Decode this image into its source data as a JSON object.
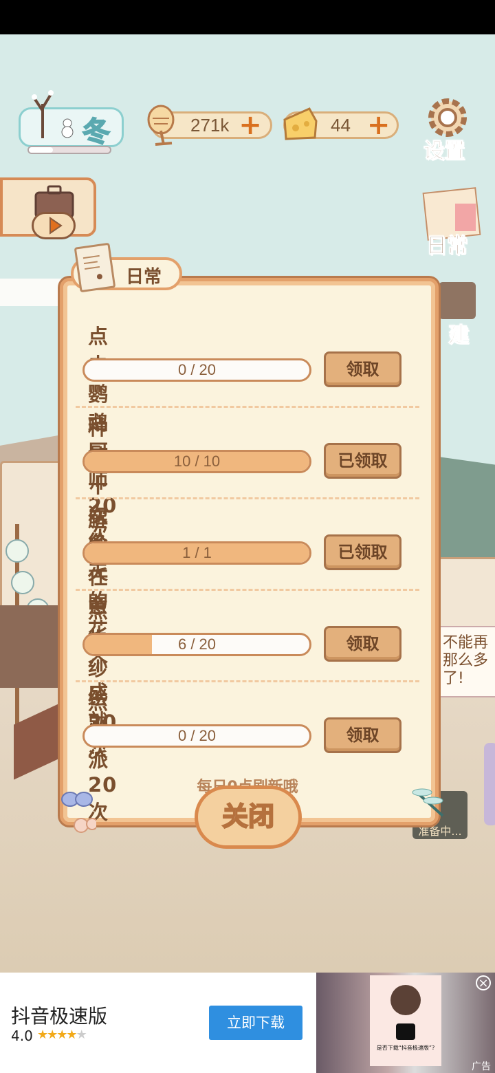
{
  "hud": {
    "season_label": "冬",
    "fish_value": "271k",
    "cheese_value": "44",
    "plus_symbol": "+",
    "settings_label": "设置",
    "daily_label": "日常",
    "build_label": "建"
  },
  "dialog": {
    "tab_label": "日常",
    "tasks": [
      {
        "title": "点击鹦鹉厨师20次",
        "progress_text": "0 / 20",
        "progress": 0.0,
        "button": "领取"
      },
      {
        "title": "种植十次冬天的花",
        "progress_text": "10 / 10",
        "progress": 1.0,
        "button": "已领取"
      },
      {
        "title": "解锁任意一个成就",
        "progress_text": "1 / 1",
        "progress": 1.0,
        "button": "已领取"
      },
      {
        "title": "点击纱绘20次",
        "progress_text": "6 / 20",
        "progress": 0.3,
        "button": "领取"
      },
      {
        "title": "点击派20次",
        "progress_text": "0 / 20",
        "progress": 0.0,
        "button": "领取"
      }
    ],
    "footer_note": "每日0点刷新哦",
    "close_label": "关闭"
  },
  "background_text": {
    "speech_line1": "不能再",
    "speech_line2": "那么多",
    "speech_line3": "了!",
    "status_text": "准备中..."
  },
  "ad": {
    "app_name": "抖音极速版",
    "rating": "4.0",
    "stars": 4,
    "cta": "立即下载",
    "close_icon": "×",
    "corner_tag": "广告",
    "thumb_caption": "是否下载“抖音极速版”?"
  },
  "colors": {
    "accent": "#e3a06a",
    "ad_button": "#2f8fe0"
  }
}
